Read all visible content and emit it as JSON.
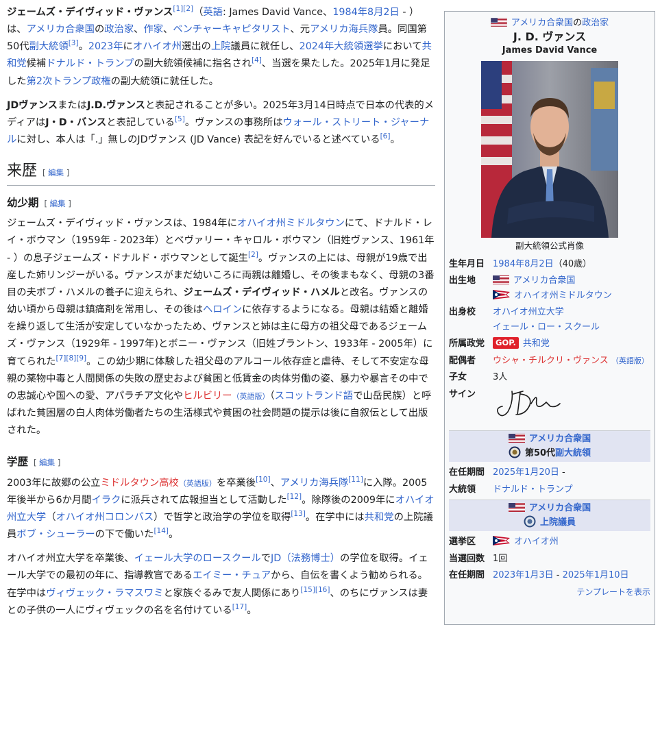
{
  "intro": {
    "p1": {
      "name": "ジェームズ・デイヴィッド・ヴァンス",
      "refs1": "[1][2]",
      "paren_open": "（",
      "eng_link": "英語",
      "eng_text": ": James David Vance、",
      "birth_link": "1984年8月2日",
      "t1": " - ）は、",
      "usa_link": "アメリカ合衆国",
      "t2": "の",
      "pol_link": "政治家",
      "t3": "、",
      "writer_link": "作家",
      "t4": "、",
      "vc_link": "ベンチャーキャピタリスト",
      "t5": "、元",
      "marines_link": "アメリカ海兵隊",
      "t6": "員。同国第50代",
      "vp_link": "副大統領",
      "ref3": "[3]",
      "t7": "。",
      "y2023_link": "2023年",
      "t8": "に",
      "ohio_link": "オハイオ州",
      "t9": "選出の",
      "senate_link": "上院",
      "t10": "議員に就任し、",
      "elec_link": "2024年大統領選挙",
      "t11": "において",
      "rep_link": "共和党",
      "t12": "候補",
      "trump_link": "ドナルド・トランプ",
      "t13": "の副大統領候補に指名され",
      "ref4": "[4]",
      "t14": "、当選を果たした。2025年1月に発足した",
      "admin_link": "第2次トランプ政権",
      "t15": "の副大統領に就任した。"
    },
    "p2": {
      "b1": "JDヴァンス",
      "t1": "または",
      "b2": "J.D.ヴァンス",
      "t2": "と表記されることが多い。2025年3月14日時点で日本の代表的メディアは",
      "b3": "J・D・バンス",
      "t3": "と表記している",
      "ref5": "[5]",
      "t4": "。ヴァンスの事務所は",
      "wsj_link": "ウォール・ストリート・ジャーナル",
      "t5": "に対し、本人は「.」無しのJDヴァンス (JD Vance) 表記を好んでいると述べている",
      "ref6": "[6]",
      "t6": "。"
    }
  },
  "section_career": {
    "title": "来歴",
    "edit_open": "[ ",
    "edit": "編集",
    "edit_close": " ]"
  },
  "section_childhood": {
    "title": "幼少期",
    "edit": "編集",
    "t1": "ジェームズ・デイヴィッド・ヴァンスは、1984年に",
    "midd_link": "オハイオ州ミドルタウン",
    "t2": "にて、ドナルド・レイ・ボウマン（1959年 - 2023年）とベヴァリー・キャロル・ボウマン（旧姓ヴァンス、1961年 - ）の息子ジェームズ・ドナルド・ボウマンとして誕生",
    "ref2": "[2]",
    "t3": "。ヴァンスの上には、母親が19歳で出産した姉リンジーがいる。ヴァンスがまだ幼いころに両親は離婚し、その後まもなく、母親の3番目の夫ボブ・ハメルの養子に迎えられ、",
    "b1": "ジェームズ・デイヴィッド・ハメル",
    "t4": "と改名。ヴァンスの幼い頃から母親は鎮痛剤を常用し、その後は",
    "heroin_link": "ヘロイン",
    "t5": "に依存するようになる。母親は結婚と離婚を繰り返して生活が安定していなかったため、ヴァンスと姉は主に母方の祖父母であるジェームズ・ヴァンス（1929年 - 1997年)とボニー・ヴァンス（旧姓ブラントン、1933年 - 2005年）に育てられた",
    "refs789": "[7][8][9]",
    "t6": "。この幼少期に体験した祖父母のアルコール依存症と虐待、そして不安定な母親の薬物中毒と人間関係の失敗の歴史および貧困と低賃金の肉体労働の姿、暴力や暴言その中での忠誠心や国への愛、アパラチア文化や",
    "hillbilly_link": "ヒルビリー",
    "eng_small": "（英語版）",
    "t7": "（",
    "scots_link": "スコットランド語",
    "t8": "で山岳民族）と呼ばれた貧困層の白人肉体労働者たちの生活様式や貧困の社会問題の提示は後に自叙伝として出版された。"
  },
  "section_education": {
    "title": "学歴",
    "edit": "編集",
    "p1": {
      "t1": "2003年に故郷の公立",
      "mhs_link": "ミドルタウン高校",
      "eng_small": "（英語版）",
      "t2": "を卒業後",
      "ref10": "[10]",
      "t3": "、",
      "usmc_link": "アメリカ海兵隊",
      "ref11": "[11]",
      "t4": "に入隊。2005年後半から6か月間",
      "iraq_link": "イラク",
      "t5": "に派兵されて広報担当として活動した",
      "ref12": "[12]",
      "t6": "。除隊後の2009年に",
      "osu_link": "オハイオ州立大学",
      "t7": "（",
      "col_link": "オハイオ州コロンバス",
      "t8": "）で哲学と政治学の学位を取得",
      "ref13": "[13]",
      "t9": "。在学中には",
      "gop_link": "共和党",
      "t10": "の上院議員",
      "schuler_link": "ボブ・シューラー",
      "t11": "の下で働いた",
      "ref14": "[14]",
      "t12": "。"
    },
    "p2": {
      "t1": "オハイオ州立大学を卒業後、",
      "yale_link": "イェール大学のロースクール",
      "t2": "で",
      "jd_link": "JD（法務博士）",
      "t3": "の学位を取得。イェール大学での最初の年に、指導教官である",
      "chua_link": "エイミー・チュア",
      "t4": "から、自伝を書くよう勧められる。在学中は",
      "vivek_link": "ヴィヴェック・ラマスワミ",
      "t5": "と家族ぐるみで友人関係にあり",
      "refs1516": "[15][16]",
      "t6": "、のちにヴァンスは妻との子供の一人にヴィヴェックの名を名付けている",
      "ref17": "[17]",
      "t7": "。"
    }
  },
  "infobox": {
    "country_link": "アメリカ合衆国",
    "no": "の",
    "role_link": "政治家",
    "title": "J. D. ヴァンス",
    "subtitle": "James David Vance",
    "caption": "副大統領公式肖像",
    "birth_label": "生年月日",
    "birth_value": "1984年8月2日",
    "birth_age": "（40歳）",
    "birthplace_label": "出生地",
    "birthplace_1": "アメリカ合衆国",
    "birthplace_2": "オハイオ州ミドルタウン",
    "school_label": "出身校",
    "school_1": "オハイオ州立大学",
    "school_2": "イェール・ロー・スクール",
    "party_label": "所属政党",
    "party_badge": "GOP.",
    "party_value": "共和党",
    "spouse_label": "配偶者",
    "spouse_value": "ウシャ・チルクリ・ヴァンス",
    "spouse_eng": "（英語版）",
    "children_label": "子女",
    "children_value": "3人",
    "sign_label": "サイン",
    "band1_country": "アメリカ合衆国",
    "band1_office_no": "第50代",
    "band1_office": "副大統領",
    "term1_label": "在任期間",
    "term1_value": "2025年1月20日",
    "term1_dash": " -",
    "pres_label": "大統領",
    "pres_value": "ドナルド・トランプ",
    "band2_country": "アメリカ合衆国",
    "band2_office": "上院議員",
    "district_label": "選挙区",
    "district_value": "オハイオ州",
    "elected_label": "当選回数",
    "elected_value": "1回",
    "term2_label": "在任期間",
    "term2_start": "2023年1月3日",
    "term2_dash": " - ",
    "term2_end": "2025年1月10日",
    "template_link": "テンプレートを表示"
  },
  "colors": {
    "link": "#3366cc",
    "red_link": "#dd3333",
    "band": "#e1e4f2",
    "gop": "#e0212b"
  }
}
